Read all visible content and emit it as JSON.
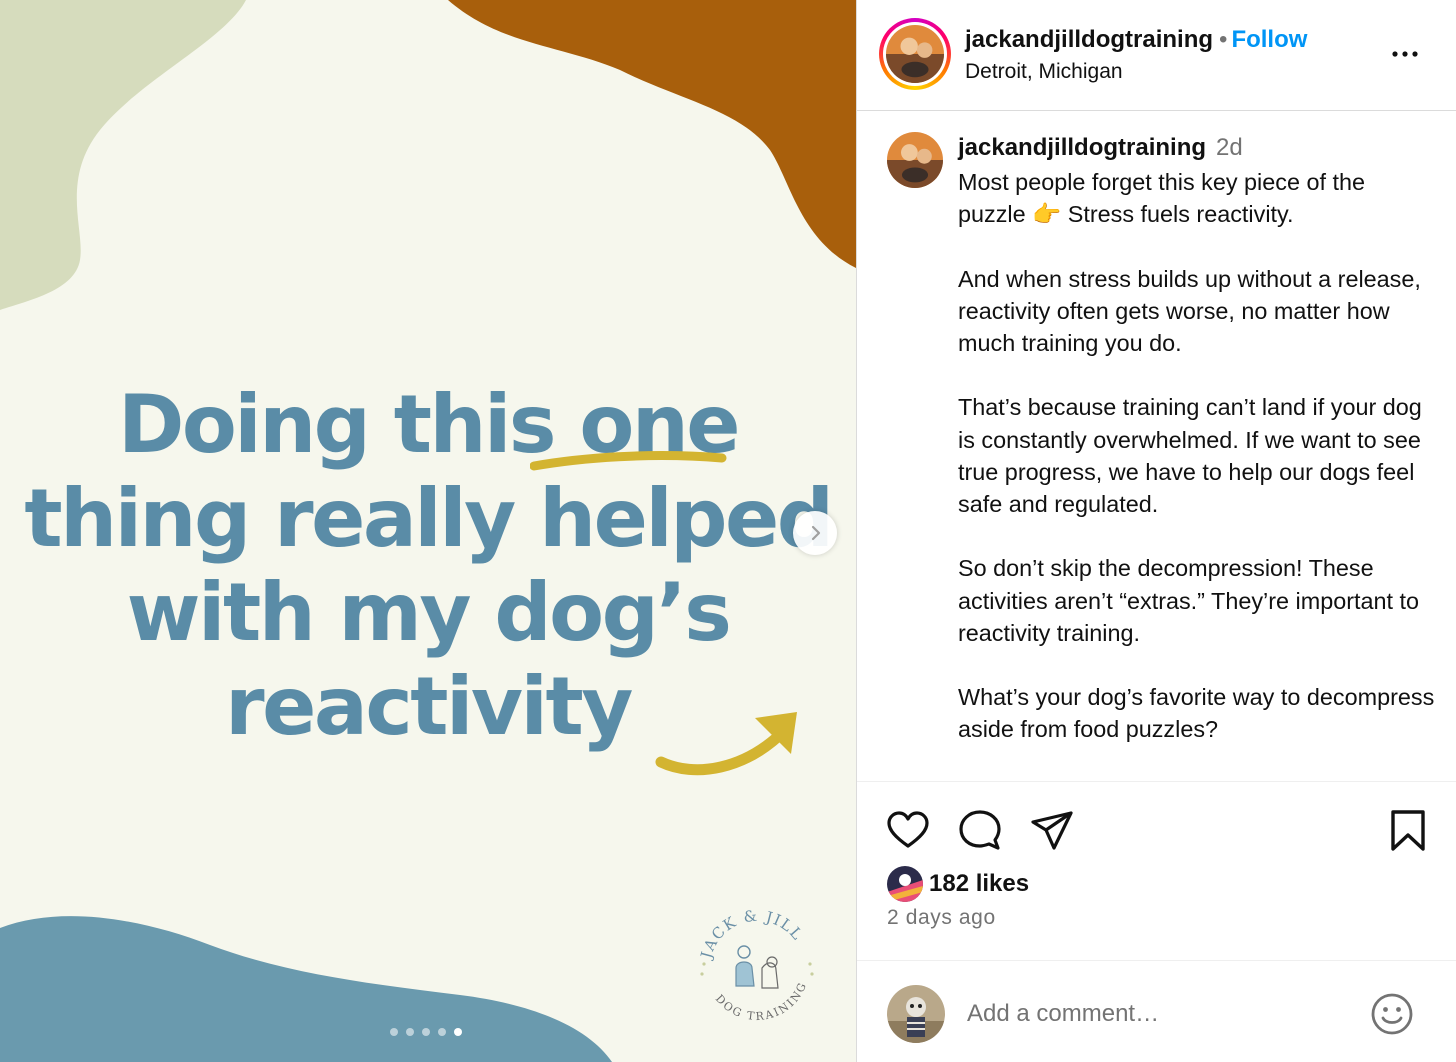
{
  "media": {
    "headline": {
      "line1_pre": "Doing this ",
      "line1_emph": "one",
      "line2": "thing really helped",
      "line3": "with my dog’s",
      "line4": "reactivity"
    },
    "logo": {
      "text_top": "JACK & JILL",
      "text_bottom": "DOG TRAINING"
    },
    "carousel": {
      "slides": 5,
      "active_index": 4
    },
    "colors": {
      "background": "#f6f7ed",
      "headline": "#5a8ca7",
      "sage_blob": "#d6dcbd",
      "rust_blob": "#a85f0c",
      "blue_blob": "#6a9aae",
      "accent_mustard": "#d3b431"
    }
  },
  "header": {
    "username": "jackandjilldogtraining",
    "separator": "•",
    "follow_label": "Follow",
    "location": "Detroit, Michigan"
  },
  "caption": {
    "username": "jackandjilldogtraining",
    "time": "2d",
    "paragraphs": [
      "Most people forget this key piece of the puzzle 👉 Stress fuels reactivity.",
      "And when stress builds up without a release, reactivity often gets worse, no matter how much training you do.",
      "That’s because training can’t land if your dog is constantly overwhelmed. If we want to see true progress, we have to help our dogs feel safe and regulated.",
      "So don’t skip the decompression! These activities aren’t “extras.” They’re important to reactivity training.",
      "What’s your dog’s favorite way to decompress aside from food puzzles?"
    ]
  },
  "engagement": {
    "likes": "182 likes",
    "time_ago": "2 days ago"
  },
  "comment": {
    "placeholder": "Add a comment…"
  },
  "icons": {
    "header_more": "more-options-icon",
    "like": "heart-icon",
    "comment": "comment-bubble-icon",
    "share": "paper-plane-icon",
    "save": "bookmark-icon",
    "emoji": "smiley-icon",
    "next": "chevron-right-icon"
  },
  "accent_colors": {
    "link_blue": "#0095f6",
    "muted_text": "#737373"
  }
}
